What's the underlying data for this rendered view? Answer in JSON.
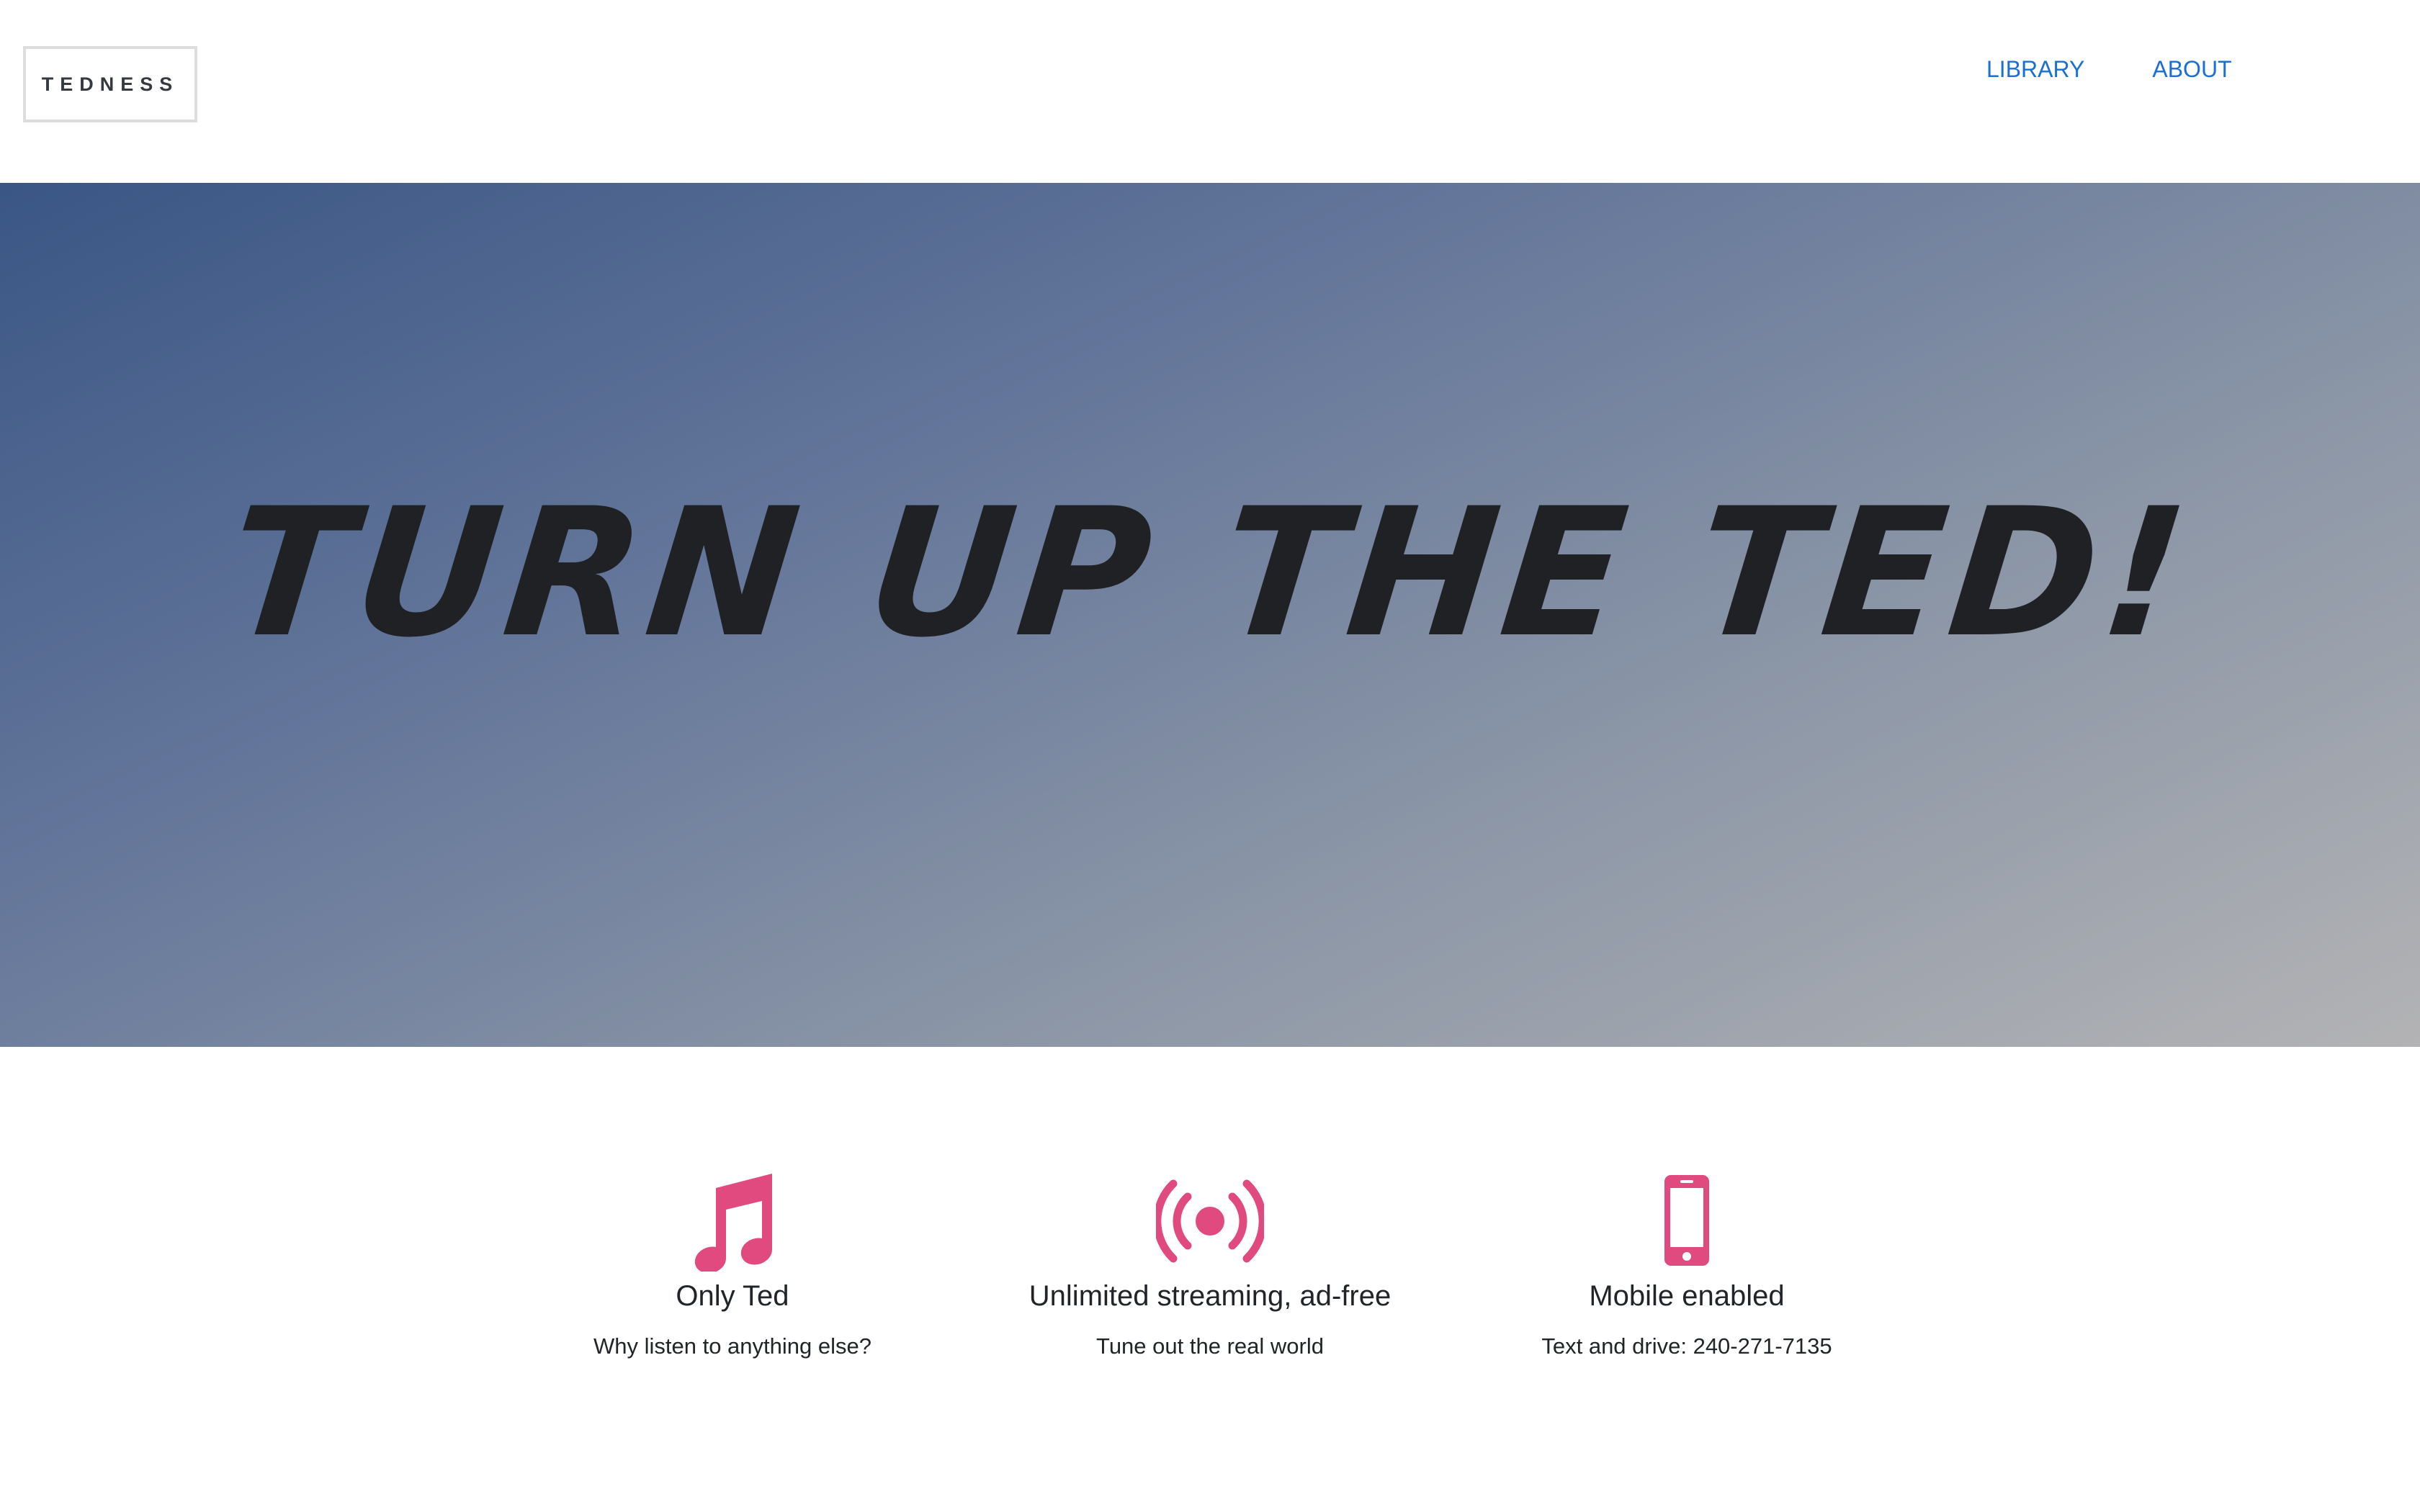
{
  "navbar": {
    "brand": "TEDNESS",
    "links": [
      {
        "label": "LIBRARY"
      },
      {
        "label": "ABOUT"
      }
    ]
  },
  "hero": {
    "title": "TURN UP THE TED!"
  },
  "features": [
    {
      "icon": "music-note-icon",
      "title": "Only Ted",
      "text": "Why listen to anything else?"
    },
    {
      "icon": "broadcast-icon",
      "title": "Unlimited streaming, ad-free",
      "text": "Tune out the real world"
    },
    {
      "icon": "mobile-phone-icon",
      "title": "Mobile enabled",
      "text": "Text and drive: 240-271-7135"
    }
  ],
  "colors": {
    "accent": "#e04a7e",
    "link": "#1a6fd6",
    "text": "#212529"
  }
}
